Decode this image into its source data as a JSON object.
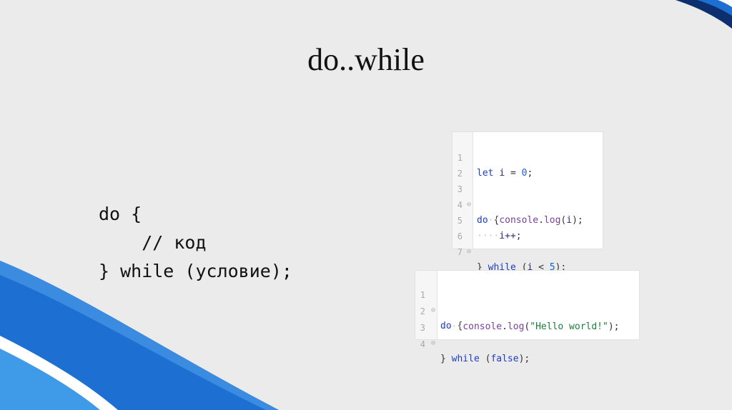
{
  "title": "do..while",
  "syntax": {
    "lines": [
      "do {",
      "    // код",
      "} while (условие);"
    ]
  },
  "example1": {
    "line_numbers": [
      "1",
      "2",
      "3",
      "4",
      "5",
      "6",
      "7"
    ],
    "l1": {
      "kw": "let",
      "var": "i",
      "op": "=",
      "num": "0",
      "semi": ";"
    },
    "l3": {
      "kw": "do",
      "brace": "{"
    },
    "l4": {
      "ws": "····",
      "obj": "console",
      "dot": ".",
      "fn": "log",
      "open": "(",
      "arg": "i",
      "close": ");"
    },
    "l5": {
      "ws": "····",
      "expr": "i++",
      "semi": ";"
    },
    "l6": {
      "brace": "}",
      "kw": "while",
      "open": "(",
      "var": "i",
      "op": "<",
      "num": "5",
      "close": ");"
    }
  },
  "example2": {
    "line_numbers": [
      "1",
      "2",
      "3",
      "4"
    ],
    "l1": {
      "kw": "do",
      "brace": "{"
    },
    "l2": {
      "ws": "····",
      "obj": "console",
      "dot": ".",
      "fn": "log",
      "open": "(",
      "str": "\"Hello world!\"",
      "close": ");"
    },
    "l3": {
      "brace": "}",
      "kw": "while",
      "open": "(",
      "val": "false",
      "close": ");"
    }
  },
  "colors": {
    "background": "#ebebeb",
    "accent_blue": "#1d6fd1",
    "accent_dark": "#0e2f6e"
  }
}
